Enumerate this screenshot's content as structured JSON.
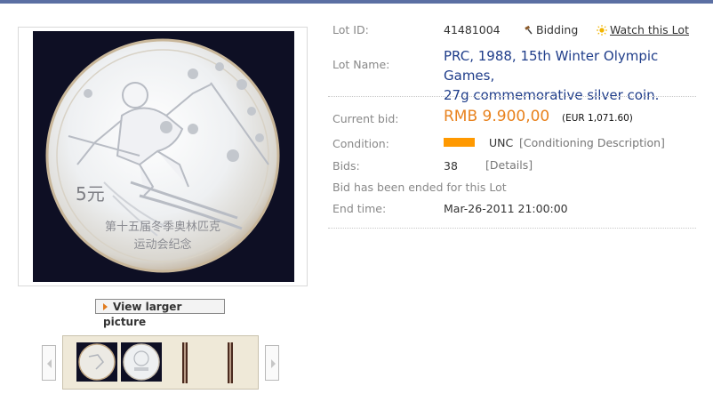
{
  "lot": {
    "id_label": "Lot ID:",
    "id_value": "41481004",
    "bidding_label": "Bidding",
    "watch_label": "Watch this Lot",
    "name_label": "Lot Name:",
    "name_line1": "PRC, 1988, 15th Winter Olympic Games,",
    "name_line2": "27g commemorative silver coin.",
    "current_bid_label": "Current bid:",
    "current_bid_value": "RMB 9.900,00",
    "current_bid_eur": "(EUR 1,071.60)",
    "condition_label": "Condition:",
    "condition_value": "UNC",
    "condition_desc": "[Conditioning Description]",
    "bids_label": "Bids:",
    "bids_value": "38",
    "bids_details": "[Details]",
    "ended_text": "Bid has been ended for this Lot",
    "end_time_label": "End time:",
    "end_time_value": "Mar-26-2011 21:00:00"
  },
  "gallery": {
    "view_larger_label": "View larger picture",
    "coin_denomination": "5元",
    "coin_inscription_1": "第十五届冬季奥林匹克",
    "coin_inscription_2": "运动会纪念"
  },
  "colors": {
    "accent_orange": "#e8821e",
    "condition_bar": "#ff9900",
    "lot_name_blue": "#1f3d8a",
    "top_bar": "#5b6fa3"
  }
}
